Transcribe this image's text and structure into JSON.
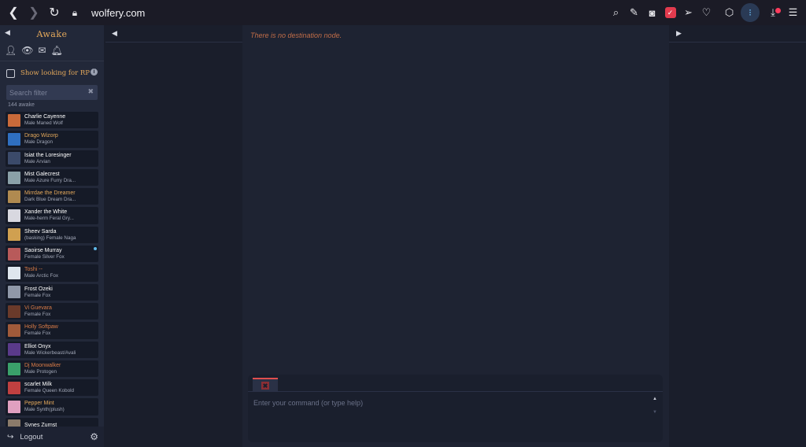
{
  "browser": {
    "url": "wolfery.com",
    "icons": [
      "back-icon",
      "forward-icon",
      "reload-icon",
      "lock-icon",
      "zoom-icon",
      "edit-icon",
      "camera-icon",
      "pocket-icon",
      "send-icon",
      "heart-icon",
      "cube-icon",
      "extension-icon",
      "download-icon",
      "menu-icon"
    ]
  },
  "sidebar": {
    "title": "Awake",
    "show_looking_label": "Show looking for RP",
    "search_placeholder": "Search filter",
    "awake_count": "144 awake",
    "characters": [
      {
        "name": "Charlie Cayenne",
        "desc": "Male Maned Wolf",
        "name_color": "white",
        "avatar": "#c96a3a"
      },
      {
        "name": "Drago Wizorp",
        "desc": "Male Dragon",
        "name_color": "gold",
        "avatar": "#2f6fc0"
      },
      {
        "name": "Isiat the Loresinger",
        "desc": "Male Arvian",
        "name_color": "white",
        "avatar": "#3b4a6a"
      },
      {
        "name": "Mist Galecrest",
        "desc": "Male Azure Furry Dra...",
        "name_color": "white",
        "avatar": "#8aa0a8"
      },
      {
        "name": "Mirrdae the Dreamer",
        "desc": "Dark Blue Dream Dra...",
        "name_color": "gold",
        "avatar": "#b08a50"
      },
      {
        "name": "Xander the White",
        "desc": "Male-herm Feral Gry...",
        "name_color": "white",
        "avatar": "#d8d8e0"
      },
      {
        "name": "Sheev Sarda",
        "desc": "(basking) Female Naga",
        "name_color": "white",
        "avatar": "#d0a050"
      },
      {
        "name": "Saoirse Murray",
        "desc": "Female Silver Fox",
        "name_color": "white",
        "avatar": "#b85a5a",
        "status": true
      },
      {
        "name": "Toshi --",
        "desc": "Male Arctic Fox",
        "name_color": "orange",
        "avatar": "#dfe6ee"
      },
      {
        "name": "Frost Ozeki",
        "desc": "Female Fox",
        "name_color": "white",
        "avatar": "#9098a8"
      },
      {
        "name": "Vi Guevara",
        "desc": "Female Fox",
        "name_color": "orange",
        "avatar": "#6a3a2a"
      },
      {
        "name": "Holly Softpaw",
        "desc": "Female Fox",
        "name_color": "orange",
        "avatar": "#a05a3a"
      },
      {
        "name": "Elliot Onyx",
        "desc": "Male Wickerbeast/Avali",
        "name_color": "white",
        "avatar": "#5a3a8a"
      },
      {
        "name": "Dj Moonwalker",
        "desc": "Male Protogen",
        "name_color": "orange",
        "avatar": "#3aa06a"
      },
      {
        "name": "scarlet Milk",
        "desc": "Female Queen Kobold",
        "name_color": "white",
        "avatar": "#c04040"
      },
      {
        "name": "Pepper Mint",
        "desc": "Male Synth(plush)",
        "name_color": "gold",
        "avatar": "#e0a0c0"
      },
      {
        "name": "Synes Zurnst",
        "desc": "",
        "name_color": "white",
        "avatar": "#8a7a6a"
      }
    ],
    "logout_label": "Logout"
  },
  "main": {
    "no_destination": "There is no destination node.",
    "command_placeholder": "Enter your command (or type help)"
  },
  "colors": {
    "accent_gold": "#e3a85b",
    "accent_orange": "#d97b47",
    "tab_red": "#e04e4e"
  }
}
